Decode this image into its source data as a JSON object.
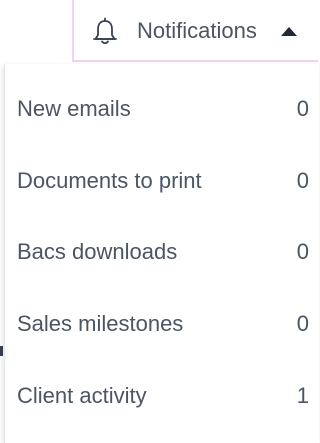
{
  "header": {
    "notifications_label": "Notifications",
    "bell_icon": "bell-icon",
    "caret_icon": "caret-up-icon"
  },
  "dropdown": {
    "items": [
      {
        "label": "New emails",
        "count": "0"
      },
      {
        "label": "Documents to print",
        "count": "0"
      },
      {
        "label": "Bacs downloads",
        "count": "0"
      },
      {
        "label": "Sales milestones",
        "count": "0"
      },
      {
        "label": "Client activity",
        "count": "1"
      }
    ]
  },
  "colors": {
    "text": "#4b5563",
    "toggle_border": "#f3d2ee"
  }
}
